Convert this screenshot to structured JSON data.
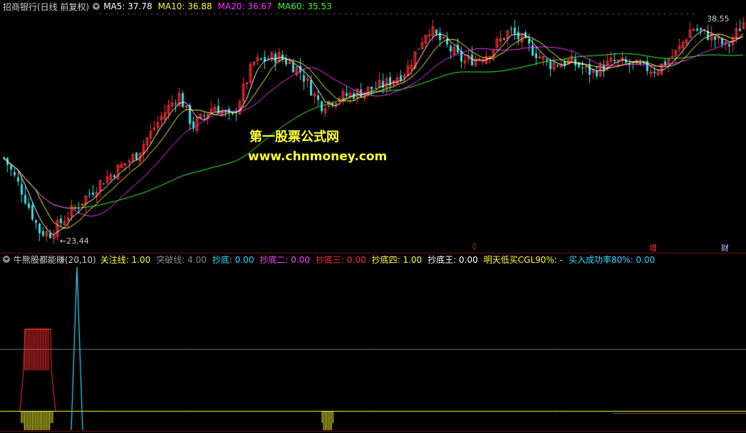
{
  "header": {
    "stock_title": "招商银行(日线 前复权)",
    "ma": [
      {
        "label": "MA5: 37.78",
        "color": "#ffffff"
      },
      {
        "label": "MA10: 36.88",
        "color": "#ffff33"
      },
      {
        "label": "MA20: 36.67",
        "color": "#ff33ff"
      },
      {
        "label": "MA60: 35.53",
        "color": "#33ff33"
      }
    ]
  },
  "price": {
    "high_label": "38.55",
    "low_label": "23.44",
    "high_value": 38.55,
    "low_value": 23.44
  },
  "watermark": {
    "line1": "第一股票公式网",
    "line2": "www.chnmoney.com"
  },
  "markers": {
    "red": "◊",
    "zeng": "增",
    "cai": "财"
  },
  "indicator": {
    "title": "牛熊股都能赚(20,10)",
    "items": [
      {
        "label": "关注线: 1.00",
        "color": "#ffff33"
      },
      {
        "label": "突破线: 4.00",
        "color": "#888888"
      },
      {
        "label": "抄底: 0.00",
        "color": "#33ddff"
      },
      {
        "label": "抄底二: 0.00",
        "color": "#ff44ff"
      },
      {
        "label": "抄底三: 0.00",
        "color": "#ff3333"
      },
      {
        "label": "抄底四: 1.00",
        "color": "#ffff33"
      },
      {
        "label": "抄底王: 0.00",
        "color": "#ffffff"
      },
      {
        "label": "明天低买CGL90%: -",
        "color": "#ffff33"
      },
      {
        "label": "买入成功率80%: 0.00",
        "color": "#33ddff"
      }
    ]
  },
  "colors": {
    "up": "#ff3333",
    "down": "#33dddd",
    "ma5": "#ffffff",
    "ma10": "#ffff33",
    "ma20": "#ff33ff",
    "ma60": "#33ff33",
    "grid": "#7a1010"
  }
}
